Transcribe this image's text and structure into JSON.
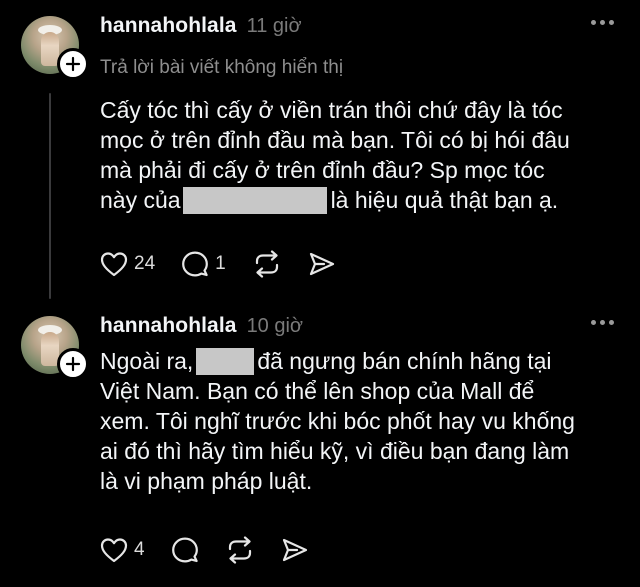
{
  "posts": [
    {
      "username": "hannahohlala",
      "time": "11 giờ",
      "subline": "Trả lời bài viết không hiển thị",
      "text_parts": [
        "Cấy tóc thì cấy ở viền trán thôi chứ đây là tóc",
        "mọc ở trên đỉnh đầu mà bạn. Tôi có bị hói đâu",
        "mà phải đi cấy ở trên đỉnh đầu? Sp mọc tóc",
        "này của",
        "là hiệu quả thật bạn ạ."
      ],
      "likes": "24",
      "replies": "1",
      "reposts": "",
      "shares": ""
    },
    {
      "username": "hannahohlala",
      "time": "10 giờ",
      "text_parts": [
        "Ngoài ra,",
        "đã ngưng bán chính hãng tại",
        "Việt Nam. Bạn có thể lên shop của Mall để",
        "xem. Tôi nghĩ trước khi bóc phốt hay vu khống",
        "ai đó thì hãy tìm hiểu kỹ, vì điều bạn đang làm",
        "là vi phạm pháp luật."
      ],
      "likes": "4",
      "replies": "",
      "reposts": "",
      "shares": ""
    }
  ],
  "icons": {
    "like": "heart-icon",
    "reply": "comment-icon",
    "repost": "repost-icon",
    "share": "send-icon",
    "more": "more-dots-icon",
    "follow": "plus-icon"
  },
  "colors": {
    "background": "#000000",
    "text": "#f3f5f7",
    "muted": "#7a7a7a",
    "redaction": "#c7c7c7"
  }
}
